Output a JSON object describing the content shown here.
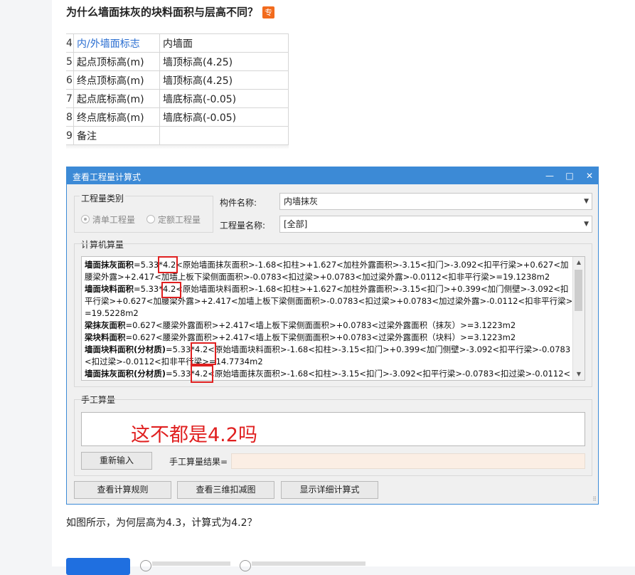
{
  "question": {
    "title": "为什么墙面抹灰的块料面积与层高不同？",
    "badge": "专"
  },
  "property_table": [
    {
      "num": "4",
      "key": "内/外墙面标志",
      "value": "内墙面",
      "highlight": true
    },
    {
      "num": "5",
      "key": "起点顶标高(m)",
      "value": "墙顶标高(4.25)",
      "highlight": false
    },
    {
      "num": "6",
      "key": "终点顶标高(m)",
      "value": "墙顶标高(4.25)",
      "highlight": false
    },
    {
      "num": "7",
      "key": "起点底标高(m)",
      "value": "墙底标高(-0.05)",
      "highlight": false
    },
    {
      "num": "8",
      "key": "终点底标高(m)",
      "value": "墙底标高(-0.05)",
      "highlight": false
    },
    {
      "num": "9",
      "key": "备注",
      "value": "",
      "highlight": false
    }
  ],
  "dialog": {
    "title": "查看工程量计算式",
    "minimize_icon": "—",
    "maximize_icon": "□",
    "close_icon": "✕",
    "quantity_type_group": "工程量类别",
    "radio_list": "清单工程量",
    "radio_quota": "定额工程量",
    "component_label": "构件名称:",
    "component_value": "内墙抹灰",
    "quantity_name_label": "工程量名称:",
    "quantity_name_value": "[全部]",
    "computer_group": "计算机算量",
    "calc_lines": [
      {
        "bold": "墙面抹灰面积",
        "text": "=5.33*4.2<原始墙面抹灰面积>-1.68<扣柱>+1.627<加柱外露面积>-3.15<扣门>-3.092<扣平行梁>+0.627<加"
      },
      {
        "bold": "",
        "text": "腰梁外露>+2.417<加墙上板下梁侧面面积>-0.0783<扣过梁>+0.0783<加过梁外露>-0.0112<扣非平行梁>=19.1238m2"
      },
      {
        "bold": "墙面块料面积",
        "text": "=5.33*4.2<原始墙面块料面积>-1.68<扣柱>+1.627<加柱外露面积>-3.15<扣门>+0.399<加门侧壁>-3.092<扣"
      },
      {
        "bold": "",
        "text": "平行梁>+0.627<加腰梁外露>+2.417<加墙上板下梁侧面面积>-0.0783<扣过梁>+0.0783<加过梁外露>-0.0112<扣非平行梁>"
      },
      {
        "bold": "",
        "text": "=19.5228m2"
      },
      {
        "bold": "梁抹灰面积",
        "text": "=0.627<腰梁外露面积>+2.417<墙上板下梁侧面面积>+0.0783<过梁外露面积（抹灰）>=3.1223m2"
      },
      {
        "bold": "梁块料面积",
        "text": "=0.627<腰梁外露面积>+2.417<墙上板下梁侧面面积>+0.0783<过梁外露面积（块料）>=3.1223m2"
      },
      {
        "bold": "墙面块料面积(分材质)",
        "text": "=5.33*4.2<原始墙面块料面积>-1.68<扣柱>-3.15<扣门>+0.399<加门侧壁>-3.092<扣平行梁>-0.0783"
      },
      {
        "bold": "",
        "text": "<扣过梁>-0.0112<扣非平行梁>=14.7734m2"
      },
      {
        "bold": "墙面抹灰面积(分材质)",
        "text": "=5.33*4.2<原始墙面抹灰面积>-1.68<扣柱>-3.15<扣门>-3.092<扣平行梁>-0.0783<扣过梁>-0.0112<"
      }
    ],
    "scroll_up": "▲",
    "scroll_down": "▼",
    "manual_group": "手工算量",
    "annotation": "这不都是4.2吗",
    "reinput_button": "重新输入",
    "manual_result_label": "手工算量结果=",
    "rules_button": "查看计算规则",
    "view3d_button": "查看三维扣减图",
    "detail_button": "显示详细计算式",
    "grip": "⠿"
  },
  "caption": "如图所示，为何层高为4.3，计算式为4.2？"
}
